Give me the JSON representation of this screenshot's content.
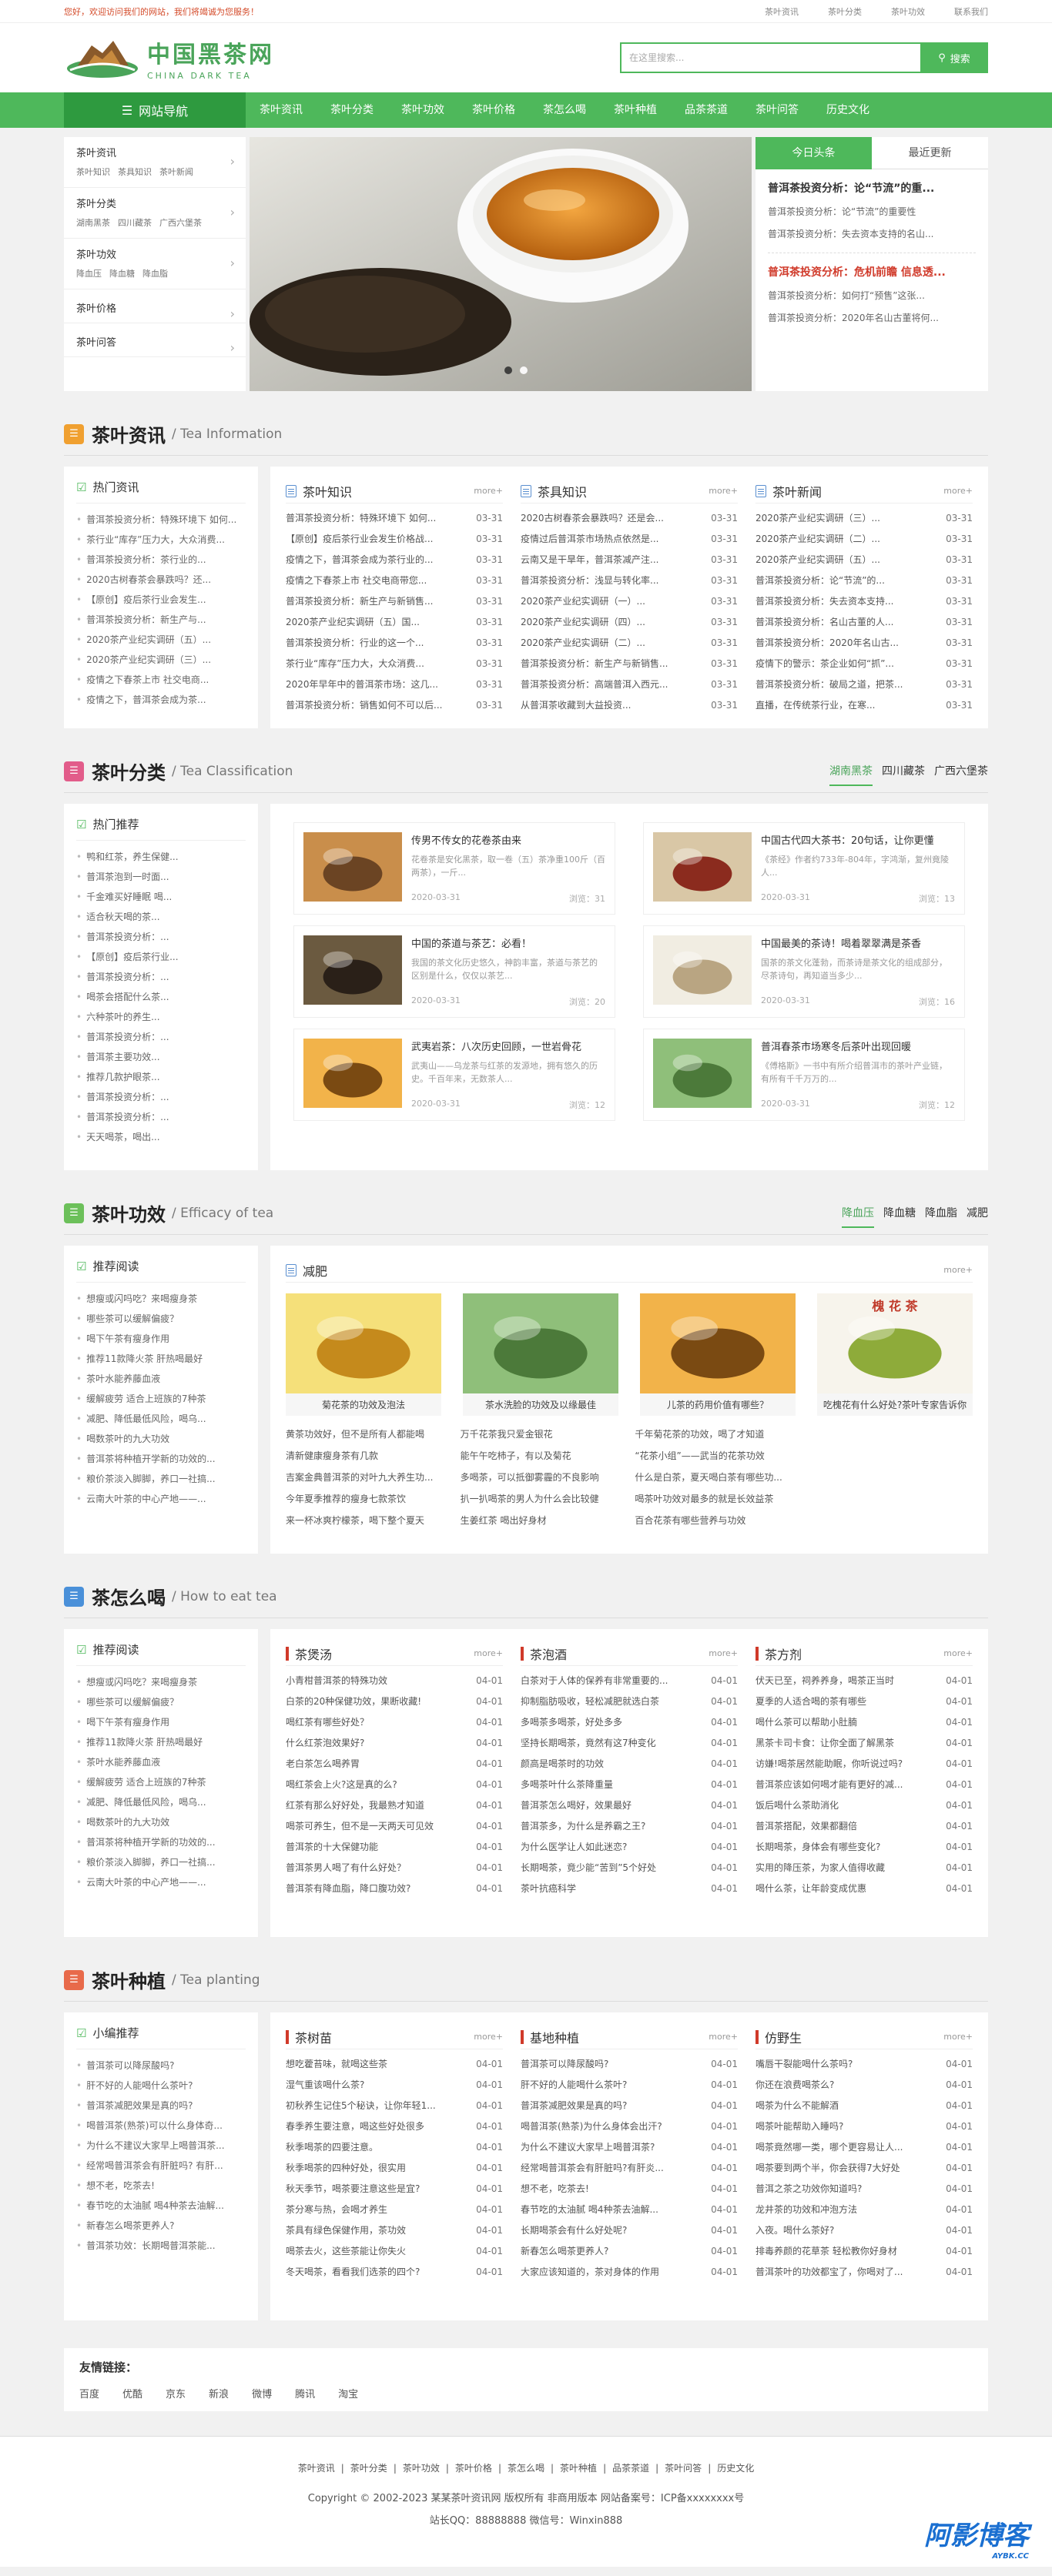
{
  "topbar": {
    "welcome": "您好，欢迎访问我们的网站，我们将竭诚为您服务！",
    "links": [
      "茶叶资讯",
      "茶叶分类",
      "茶叶功效",
      "联系我们"
    ]
  },
  "logo": {
    "cn": "中国黑茶网",
    "en": "CHINA DARK TEA"
  },
  "search": {
    "placeholder": "在这里搜索...",
    "button": "搜索"
  },
  "nav": {
    "home": "网站导航",
    "items": [
      "茶叶资讯",
      "茶叶分类",
      "茶叶功效",
      "茶叶价格",
      "茶怎么喝",
      "茶叶种植",
      "品茶茶道",
      "茶叶问答",
      "历史文化"
    ]
  },
  "categories": [
    {
      "title": "茶叶资讯",
      "subs": [
        "茶叶知识",
        "茶具知识",
        "茶叶新闻"
      ]
    },
    {
      "title": "茶叶分类",
      "subs": [
        "湖南黑茶",
        "四川藏茶",
        "广西六堡茶"
      ]
    },
    {
      "title": "茶叶功效",
      "subs": [
        "降血压",
        "降血糖",
        "降血脂"
      ]
    },
    {
      "title": "茶叶价格",
      "subs": []
    },
    {
      "title": "茶叶问答",
      "subs": []
    }
  ],
  "headlines": {
    "tabs": [
      "今日头条",
      "最近更新"
    ],
    "blocks": [
      {
        "title": "普洱茶投资分析：论“节流”的重...",
        "lines": [
          "普洱茶投资分析：论“节流”的重要性",
          "普洱茶投资分析：失去资本支持的名山..."
        ],
        "red": false
      },
      {
        "title": "普洱茶投资分析：危机前瞻 信息透...",
        "lines": [
          "普洱茶投资分析：如何打“预售”这张...",
          "普洱茶投资分析：2020年名山古董将何..."
        ],
        "red": true
      }
    ]
  },
  "sections": {
    "info": {
      "cn": "茶叶资讯",
      "en": "/ Tea Information",
      "icon_color": "#f0a030"
    },
    "classification": {
      "cn": "茶叶分类",
      "en": "/ Tea Classification",
      "icon_color": "#e25c8a",
      "tabs": [
        "湖南黑茶",
        "四川藏茶",
        "广西六堡茶"
      ]
    },
    "efficacy": {
      "cn": "茶叶功效",
      "en": "/ Efficacy of tea",
      "icon_color": "#6cc05a",
      "tabs": [
        "降血压",
        "降血糖",
        "降血脂",
        "减肥"
      ]
    },
    "howto": {
      "cn": "茶怎么喝",
      "en": "/ How to eat tea",
      "icon_color": "#4a90d9"
    },
    "planting": {
      "cn": "茶叶种植",
      "en": "/ Tea planting",
      "icon_color": "#e86a4a"
    }
  },
  "info_side": {
    "title": "热门资讯",
    "items": [
      "普洱茶投资分析：特殊环境下 如何...",
      "茶行业“库存”压力大，大众消费...",
      "普洱茶投资分析：茶行业的...",
      "2020古树春茶会暴跌吗？还...",
      "【原创】疫后茶行业会发生...",
      "普洱茶投资分析：新生产与...",
      "2020茶产业纪实调研（五）...",
      "2020茶产业纪实调研（三）...",
      "疫情之下春茶上市 社交电商...",
      "疫情之下，普洱茶会成为茶..."
    ]
  },
  "info_cols": [
    {
      "title": "茶叶知识",
      "more": "more+",
      "rows": [
        [
          "普洱茶投资分析：特殊环境下 如何...",
          "03-31"
        ],
        [
          "【原创】疫后茶行业会发生价格战...",
          "03-31"
        ],
        [
          "疫情之下，普洱茶会成为茶行业的...",
          "03-31"
        ],
        [
          "疫情之下春茶上市 社交电商带您...",
          "03-31"
        ],
        [
          "普洱茶投资分析：新生产与新销售...",
          "03-31"
        ],
        [
          "2020茶产业纪实调研（五）国...",
          "03-31"
        ],
        [
          "普洱茶投资分析：行业的这一个...",
          "03-31"
        ],
        [
          "茶行业“库存”压力大，大众消费...",
          "03-31"
        ],
        [
          "2020年早年中的普洱茶市场：这几...",
          "03-31"
        ],
        [
          "普洱茶投资分析：销售如何不可以后...",
          "03-31"
        ]
      ]
    },
    {
      "title": "茶具知识",
      "more": "more+",
      "rows": [
        [
          "2020古树春茶会暴跌吗？还是会...",
          "03-31"
        ],
        [
          "疫情过后普洱茶市场热点依然是...",
          "03-31"
        ],
        [
          "云南又是干旱年，普洱茶减产注...",
          "03-31"
        ],
        [
          "普洱茶投资分析：浅显与转化率...",
          "03-31"
        ],
        [
          "2020茶产业纪实调研（一）...",
          "03-31"
        ],
        [
          "2020茶产业纪实调研（四）...",
          "03-31"
        ],
        [
          "2020茶产业纪实调研（二）...",
          "03-31"
        ],
        [
          "普洱茶投资分析：新生产与新销售...",
          "03-31"
        ],
        [
          "普洱茶投资分析：高端普洱入西元...",
          "03-31"
        ],
        [
          "从普洱茶收藏到大益投资...",
          "03-31"
        ]
      ]
    },
    {
      "title": "茶叶新闻",
      "more": "more+",
      "rows": [
        [
          "2020茶产业纪实调研（三）...",
          "03-31"
        ],
        [
          "2020茶产业纪实调研（二）...",
          "03-31"
        ],
        [
          "2020茶产业纪实调研（五）...",
          "03-31"
        ],
        [
          "普洱茶投资分析：论“节流”的...",
          "03-31"
        ],
        [
          "普洱茶投资分析：失去资本支持...",
          "03-31"
        ],
        [
          "普洱茶投资分析：名山古董的人...",
          "03-31"
        ],
        [
          "普洱茶投资分析：2020年名山古...",
          "03-31"
        ],
        [
          "疫情下的警示：茶企业如何“抓”...",
          "03-31"
        ],
        [
          "普洱茶投资分析：破局之道，把茶...",
          "03-31"
        ],
        [
          "直播，在传统茶行业，在寒...",
          "03-31"
        ]
      ]
    }
  ],
  "class_side": {
    "title": "热门推荐",
    "items": [
      "鸭和红茶，养生保健...",
      "普洱茶泡到一时面...",
      "千金难买好睡眠 喝...",
      "适合秋天喝的茶...",
      "普洱茶投资分析：...",
      "【原创】疫后茶行业...",
      "普洱茶投资分析：...",
      "喝茶会搭配什么茶...",
      "六种茶叶的养生...",
      "普洱茶投资分析：...",
      "普洱茶主要功效...",
      "推荐几款护眼茶...",
      "普洱茶投资分析：...",
      "普洱茶投资分析：...",
      "天天喝茶，喝出..."
    ]
  },
  "class_cards": [
    {
      "title": "传男不传女的花卷茶由来",
      "desc": "花卷茶是安化黑茶，取一卷（五）茶净重100斤（百两茶），一斤...",
      "date": "2020-03-31",
      "views": "浏览：31",
      "tone": "brown"
    },
    {
      "title": "中国古代四大茶书：20句话，让你更懂",
      "desc": "《茶经》作者约733年-804年，字鸿渐，复州竟陵人...",
      "date": "2020-03-31",
      "views": "浏览：13",
      "tone": "red"
    },
    {
      "title": "中国的茶道与茶艺：必看！",
      "desc": "我国的茶文化历史悠久，神韵丰富，茶道与茶艺的区别是什么，仅仅以茶艺...",
      "date": "2020-03-31",
      "views": "浏览：20",
      "tone": "dark"
    },
    {
      "title": "中国最美的茶诗！喝着翠翠满是茶香",
      "desc": "国茶的茶文化蓬勃，而茶诗是茶文化的组成部分，尽茶诗句，再知道当多少...",
      "date": "2020-03-31",
      "views": "浏览：16",
      "tone": "light"
    },
    {
      "title": "武夷岩茶：八次历史回顾，一世岩骨花",
      "desc": "武夷山——乌龙茶与红茶的发源地，拥有悠久的历史。千百年来，无数茶人...",
      "date": "2020-03-31",
      "views": "浏览：12",
      "tone": "amber"
    },
    {
      "title": "普洱春茶市场寒冬后茶叶出现回暖",
      "desc": "《傅格斯》一书中有所介绍普洱市的茶叶产业链，有所有千千万万的...",
      "date": "2020-03-31",
      "views": "浏览：12",
      "tone": "green"
    }
  ],
  "eff_side": {
    "title": "推荐阅读",
    "items": [
      "想瘦或闪吗吃？来喝瘦身茶",
      "哪些茶可以缓解偏疲？",
      "喝下午茶有瘦身作用",
      "推荐11款降火茶 肝热喝最好",
      "茶叶水能养藤血液",
      "缓解疲劳 适合上班族的7种茶",
      "减肥、降低最低风险，喝乌...",
      "喝数茶叶的九大功效",
      "普洱茶将种植开学新的功效的...",
      "粮价茶淡入脚脚，养口一社搞...",
      "云南大叶茶的中心产地——..."
    ]
  },
  "eff_main": {
    "title": "减肥",
    "more": "more+",
    "pics": [
      {
        "cap": "菊花茶的功效及泡法",
        "tone": "yellow"
      },
      {
        "cap": "茶水洗脸的功效及以缘最佳",
        "tone": "green"
      },
      {
        "cap": "儿茶的药用价值有哪些？",
        "tone": "amber"
      },
      {
        "cap": "吃槐花有什么好处?茶叶专家告诉你",
        "tone": "plate",
        "label": "槐 花 茶"
      }
    ],
    "cols": [
      [
        "黄茶功效好，但不是所有人都能喝",
        "清新健康瘦身茶有几款",
        "吉案金典普洱茶的对叶九大养生功...",
        "今年夏季推荐的瘦身七款茶饮",
        "来一杯冰爽柠檬茶，喝下整个夏天"
      ],
      [
        "万千花茶我只爱金银花",
        "能午午吃柿子，有以及菊花",
        "多喝茶，可以抵御雾霾的不良影响",
        "扒一扒喝茶的男人为什么会比较健",
        "生姜红茶 喝出好身材"
      ],
      [
        "千年菊花茶的功效，喝了才知道",
        "“花茶小组”——武当的花茶功效",
        "什么是白茶，夏天喝白茶有哪些功...",
        "喝茶叶功效对最多的就是长效益茶",
        "百合花茶有哪些营养与功效"
      ],
      [
        "",
        "",
        "",
        "",
        ""
      ]
    ]
  },
  "howto_side": {
    "title": "推荐阅读",
    "items": [
      "想瘦或闪吗吃？来喝瘦身茶",
      "哪些茶可以缓解偏疲？",
      "喝下午茶有瘦身作用",
      "推荐11款降火茶 肝热喝最好",
      "茶叶水能养藤血液",
      "缓解疲劳 适合上班族的7种茶",
      "减肥、降低最低风险，喝乌...",
      "喝数茶叶的九大功效",
      "普洱茶将种植开学新的功效的...",
      "粮价茶淡入脚脚，养口一社搞...",
      "云南大叶茶的中心产地——..."
    ]
  },
  "howto_cols": [
    {
      "title": "茶煲汤",
      "more": "more+",
      "rows": [
        [
          "小青柑普洱茶的特殊功效",
          "04-01"
        ],
        [
          "白茶的20种保健功效，果断收藏!",
          "04-01"
        ],
        [
          "喝红茶有哪些好处？",
          "04-01"
        ],
        [
          "什么红茶泡效果好?",
          "04-01"
        ],
        [
          "老白茶怎么喝养胃",
          "04-01"
        ],
        [
          "喝红茶会上火?这是真的么?",
          "04-01"
        ],
        [
          "红茶有那么好好处，我最熟才知道",
          "04-01"
        ],
        [
          "喝茶可养生，但不是一天两天可见效",
          "04-01"
        ],
        [
          "普洱茶的十大保健功能",
          "04-01"
        ],
        [
          "普洱茶男人喝了有什么好处？",
          "04-01"
        ],
        [
          "普洱茶有降血脂，降口腹功效?",
          "04-01"
        ]
      ]
    },
    {
      "title": "茶泡酒",
      "more": "more+",
      "rows": [
        [
          "白茶对于人体的保养有非常重要的...",
          "04-01"
        ],
        [
          "抑制脂肪吸收，轻松减肥就选白茶",
          "04-01"
        ],
        [
          "多喝茶多喝茶，好处多多",
          "04-01"
        ],
        [
          "坚持长期喝茶，竟然有这7种变化",
          "04-01"
        ],
        [
          "颜高是喝茶时的功效",
          "04-01"
        ],
        [
          "多喝茶叶什么茶降重量",
          "04-01"
        ],
        [
          "普洱茶怎么喝好，效果最好",
          "04-01"
        ],
        [
          "普洱茶多，为什么是养霸之王?",
          "04-01"
        ],
        [
          "为什么医学让人如此迷恋?",
          "04-01"
        ],
        [
          "长期喝茶，竟少能“苦到”5个好处",
          "04-01"
        ],
        [
          "茶叶抗癌科学",
          "04-01"
        ]
      ]
    },
    {
      "title": "茶方剂",
      "more": "more+",
      "rows": [
        [
          "伏天已至，祠养养身，喝茶正当时",
          "04-01"
        ],
        [
          "夏季的人适合喝的茶有哪些",
          "04-01"
        ],
        [
          "喝什么茶可以帮助小肚腩",
          "04-01"
        ],
        [
          "黑茶卡司卡食：让你全面了解黑茶",
          "04-01"
        ],
        [
          "访嫌!喝茶居然能助眠，你听说过吗?",
          "04-01"
        ],
        [
          "普洱茶应该如何喝才能有更好的减...",
          "04-01"
        ],
        [
          "饭后喝什么茶助消化",
          "04-01"
        ],
        [
          "普洱茶搭配，效果都翻倍",
          "04-01"
        ],
        [
          "长期喝茶，身体会有哪些变化?",
          "04-01"
        ],
        [
          "实用的降压茶，为家人值得收藏",
          "04-01"
        ],
        [
          "喝什么茶，让年龄变成优惠",
          "04-01"
        ]
      ]
    }
  ],
  "plant_side": {
    "title": "小编推荐",
    "items": [
      "普洱茶可以降尿酸吗?",
      "肝不好的人能喝什么茶叶?",
      "普洱茶减肥效果是真的吗?",
      "喝普洱茶(熟茶)可以什么身体奇...",
      "为什么不建议大家早上喝普洱茶...",
      "经常喝普洱茶会有肝脏吗? 有肝...",
      "想不老，吃茶去!",
      "春节吃的太油腻 喝4种茶去油解...",
      "新春怎么喝茶更养人?",
      "普洱茶功效：长期喝普洱茶能..."
    ]
  },
  "plant_cols": [
    {
      "title": "茶树苗",
      "more": "more+",
      "rows": [
        [
          "想吃藿苔味，就喝这些茶",
          "04-01"
        ],
        [
          "湿气重该喝什么茶?",
          "04-01"
        ],
        [
          "初秋养生记住5个秘诀，让你年轻1...",
          "04-01"
        ],
        [
          "春季养生要注意，喝这些好处很多",
          "04-01"
        ],
        [
          "秋季喝茶的四要注意。",
          "04-01"
        ],
        [
          "秋季喝茶的四种好处，很实用",
          "04-01"
        ],
        [
          "秋天季节，喝茶要注意这些是宜?",
          "04-01"
        ],
        [
          "茶分寒与热，会喝才养生",
          "04-01"
        ],
        [
          "茶具有绿色保健作用，茶功效",
          "04-01"
        ],
        [
          "喝茶去火，这些茶能让你失火",
          "04-01"
        ],
        [
          "冬天喝茶，看看我们选茶的四个?",
          "04-01"
        ]
      ]
    },
    {
      "title": "基地种植",
      "more": "more+",
      "rows": [
        [
          "普洱茶可以降尿酸吗?",
          "04-01"
        ],
        [
          "肝不好的人能喝什么茶叶?",
          "04-01"
        ],
        [
          "普洱茶减肥效果是真的吗?",
          "04-01"
        ],
        [
          "喝普洱茶(熟茶)为什么身体会出汗?",
          "04-01"
        ],
        [
          "为什么不建议大家早上喝普洱茶?",
          "04-01"
        ],
        [
          "经常喝普洱茶会有肝脏吗?有肝炎...",
          "04-01"
        ],
        [
          "想不老，吃茶去!",
          "04-01"
        ],
        [
          "春节吃的太油腻 喝4种茶去油解...",
          "04-01"
        ],
        [
          "长期喝茶会有什么好处呢?",
          "04-01"
        ],
        [
          "新春怎么喝茶更养人?",
          "04-01"
        ],
        [
          "大家应该知道的，茶对身体的作用",
          "04-01"
        ]
      ]
    },
    {
      "title": "仿野生",
      "more": "more+",
      "rows": [
        [
          "嘴唇干裂能喝什么茶吗?",
          "04-01"
        ],
        [
          "你还在浪费喝茶么?",
          "04-01"
        ],
        [
          "喝茶为什么不能解酒",
          "04-01"
        ],
        [
          "喝茶叶能帮助入睡吗?",
          "04-01"
        ],
        [
          "喝茶竟然哪一类，哪个更容易让人...",
          "04-01"
        ],
        [
          "喝茶要到两个半，你会获得7大好处",
          "04-01"
        ],
        [
          "普洱之茶之功效你知道吗?",
          "04-01"
        ],
        [
          "龙井茶的功效和冲泡方法",
          "04-01"
        ],
        [
          "入夜。喝什么茶好?",
          "04-01"
        ],
        [
          "排毒养颜的花草茶 轻松教你好身材",
          "04-01"
        ],
        [
          "普洱茶叶的功效都宝了，你喝对了...",
          "04-01"
        ]
      ]
    }
  ],
  "links": {
    "title": "友情链接：",
    "items": [
      "百度",
      "优酷",
      "京东",
      "新浪",
      "微博",
      "腾讯",
      "淘宝"
    ]
  },
  "footer": {
    "links": [
      "茶叶资讯",
      "茶叶分类",
      "茶叶功效",
      "茶叶价格",
      "茶怎么喝",
      "茶叶种植",
      "品茶茶道",
      "茶叶问答",
      "历史文化"
    ],
    "copyright": "Copyright © 2002-2023 某某茶叶资讯网 版权所有 非商用版本  网站备案号：ICP备xxxxxxxx号",
    "contact": "站长QQ：88888888 微信号：Winxin888",
    "watermark": "阿影博客",
    "watermark_sub": "AYBK.CC"
  }
}
